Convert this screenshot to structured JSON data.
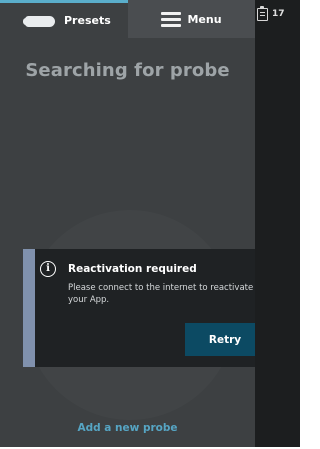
{
  "topbar": {
    "presets_label": "Presets",
    "menu_label": "Menu",
    "badge_count": "17",
    "accent_color": "#5aaecb"
  },
  "icons": {
    "presets": "probe-icon",
    "menu": "hamburger-icon",
    "badge": "clipboard-icon",
    "info": "info-icon"
  },
  "main": {
    "title": "Searching for probe",
    "add_probe_link": "Add a new probe"
  },
  "dialog": {
    "info_glyph": "i",
    "title": "Reactivation required",
    "body": "Please connect to the internet to reactivate your App.",
    "retry_label": "Retry"
  }
}
